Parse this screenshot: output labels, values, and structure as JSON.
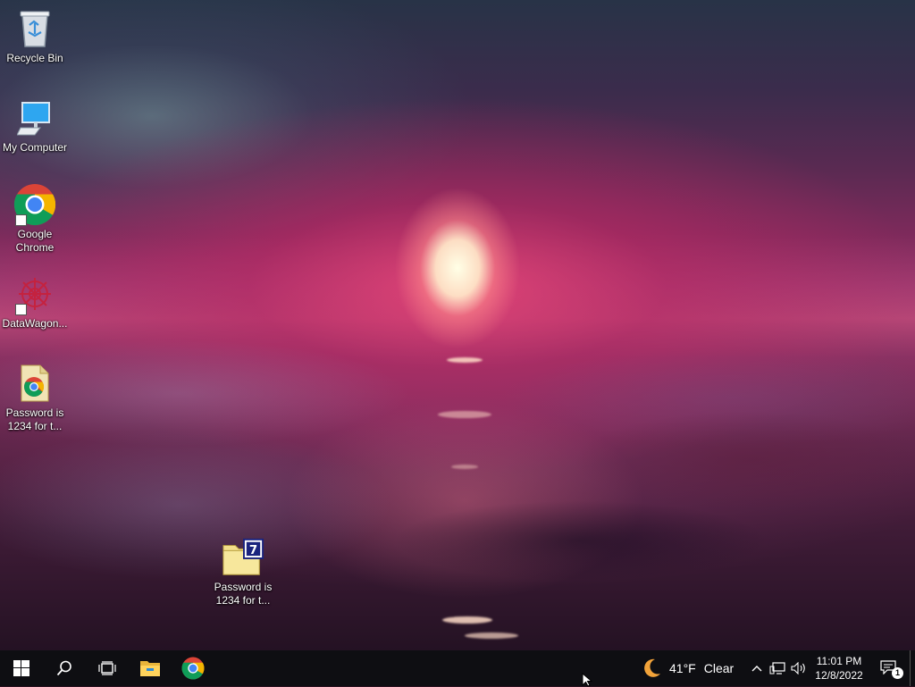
{
  "desktop": {
    "icons": [
      {
        "label": "Recycle Bin",
        "icon": "recycle-bin-icon"
      },
      {
        "label": "My Computer",
        "icon": "computer-icon"
      },
      {
        "label": "Google\nChrome",
        "icon": "chrome-icon"
      },
      {
        "label": "DataWagon...",
        "icon": "datawagon-icon"
      },
      {
        "label": "Password is\n1234 for t...",
        "icon": "chrome-file-icon"
      },
      {
        "label": "Password is\n1234 for t...",
        "icon": "7zip-folder-icon"
      }
    ]
  },
  "taskbar": {
    "start": "start-button",
    "search": "search-icon",
    "task_view": "task-view-icon",
    "pinned": [
      "file-explorer-icon",
      "chrome-icon"
    ],
    "weather": {
      "temp": "41°F",
      "condition": "Clear",
      "icon": "moon-icon"
    },
    "tray_icons": [
      "chevron-up-icon",
      "network-icon",
      "volume-icon"
    ],
    "clock": {
      "time": "11:01 PM",
      "date": "12/8/2022"
    },
    "notifications": {
      "count": "1"
    }
  },
  "colors": {
    "taskbar_bg": "#0e0e12",
    "accent_blue": "#0078d7"
  }
}
